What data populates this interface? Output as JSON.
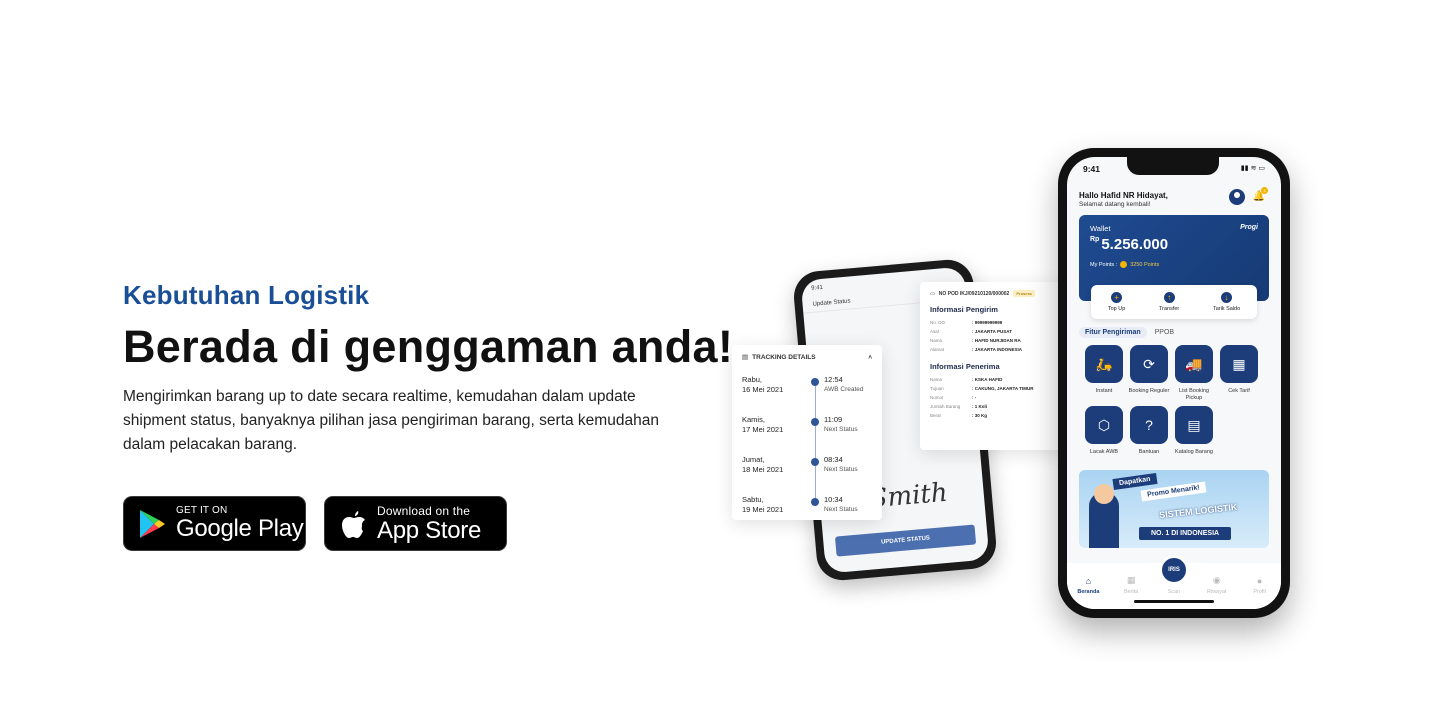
{
  "hero": {
    "kicker": "Kebutuhan Logistik",
    "headline": "Berada di genggaman anda!",
    "description": "Mengirimkan barang up to date secara realtime, kemudahan dalam update shipment status, banyaknya pilihan jasa pengiriman barang, serta kemudahan dalam pelacakan barang."
  },
  "stores": {
    "google_small": "GET IT ON",
    "google_big": "Google Play",
    "apple_small": "Download on the",
    "apple_big": "App Store"
  },
  "back_phone": {
    "time": "9:41",
    "header": "Update Status",
    "button": "UPDATE STATUS",
    "signature": "Smith"
  },
  "pod_card": {
    "pod_id": "NO POD IKJ/09210120/000002",
    "badge": "Prosess",
    "sender_title": "Informasi Pengirim",
    "sender": [
      {
        "k": "No. DO",
        "v": "99999999999"
      },
      {
        "k": "Asal",
        "v": "JAKARTA PUSAT"
      },
      {
        "k": "Nama",
        "v": "HAFID NURJIDAN RA"
      },
      {
        "k": "Alamat",
        "v": "JAKARTA INDONESIA"
      }
    ],
    "receiver_title": "Informasi Penerima",
    "receiver": [
      {
        "k": "Nama",
        "v": "KSKA HAFID"
      },
      {
        "k": "Tujuan",
        "v": "CAKUNG, JAKARTA TIMUR"
      },
      {
        "k": "Nomor",
        "v": "-"
      },
      {
        "k": "Jumlah Barang",
        "v": "1 Koli"
      },
      {
        "k": "Berat",
        "v": "30 Kg"
      }
    ]
  },
  "tracking": {
    "title": "TRACKING DETAILS",
    "items": [
      {
        "day": "Rabu,",
        "date": "16 Mei 2021",
        "time": "12:54",
        "status": "AWB Created"
      },
      {
        "day": "Kamis,",
        "date": "17 Mei 2021",
        "time": "11:09",
        "status": "Next Status"
      },
      {
        "day": "Jumat,",
        "date": "18 Mei 2021",
        "time": "08:34",
        "status": "Next Status"
      },
      {
        "day": "Sabtu,",
        "date": "19 Mei 2021",
        "time": "10:34",
        "status": "Next Status"
      }
    ]
  },
  "front_phone": {
    "time": "9:41",
    "greeting_name": "Hallo Hafid NR Hidayat,",
    "greeting_sub": "Selamat datang kembali!",
    "notif_count": "3",
    "wallet": {
      "label": "Wallet",
      "currency": "Rp",
      "amount": "5.256.000",
      "points_label": "My Points :",
      "points_value": "3250 Points",
      "brand": "Progi"
    },
    "wallet_actions": [
      {
        "icon": "+",
        "label": "Top Up"
      },
      {
        "icon": "↑",
        "label": "Transfer"
      },
      {
        "icon": "↓",
        "label": "Tarik Saldo"
      }
    ],
    "tabs": {
      "active": "Fitur Pengiriman",
      "other": "PPOB"
    },
    "features": [
      {
        "icon": "🛵",
        "label": "Instant",
        "name": "instant-icon"
      },
      {
        "icon": "⟳",
        "label": "Booking Reguler",
        "name": "booking-reguler-icon"
      },
      {
        "icon": "🚚",
        "label": "List Booking Pickup",
        "name": "list-booking-icon"
      },
      {
        "icon": "▦",
        "label": "Cek Tarif",
        "name": "cek-tarif-icon"
      },
      {
        "icon": "⬡",
        "label": "Lacak AWB",
        "name": "lacak-awb-icon"
      },
      {
        "icon": "?",
        "label": "Bantuan",
        "name": "bantuan-icon"
      },
      {
        "icon": "▤",
        "label": "Katalog Barang",
        "name": "katalog-icon"
      }
    ],
    "banner": {
      "tag1": "Dapatkan",
      "tag2": "Promo Menarik!",
      "title": "SISTEM LOGISTIK",
      "pill": "NO. 1 DI INDONESIA"
    },
    "scan_label": "IRIS",
    "nav": [
      {
        "icon": "⌂",
        "label": "Beranda"
      },
      {
        "icon": "▦",
        "label": "Berita"
      },
      {
        "icon": "",
        "label": "Scan"
      },
      {
        "icon": "◉",
        "label": "Riwayat"
      },
      {
        "icon": "●",
        "label": "Profil"
      }
    ]
  },
  "colors": {
    "primary": "#1c3d7a",
    "kicker": "#1a4f97",
    "accent": "#f2b400"
  }
}
